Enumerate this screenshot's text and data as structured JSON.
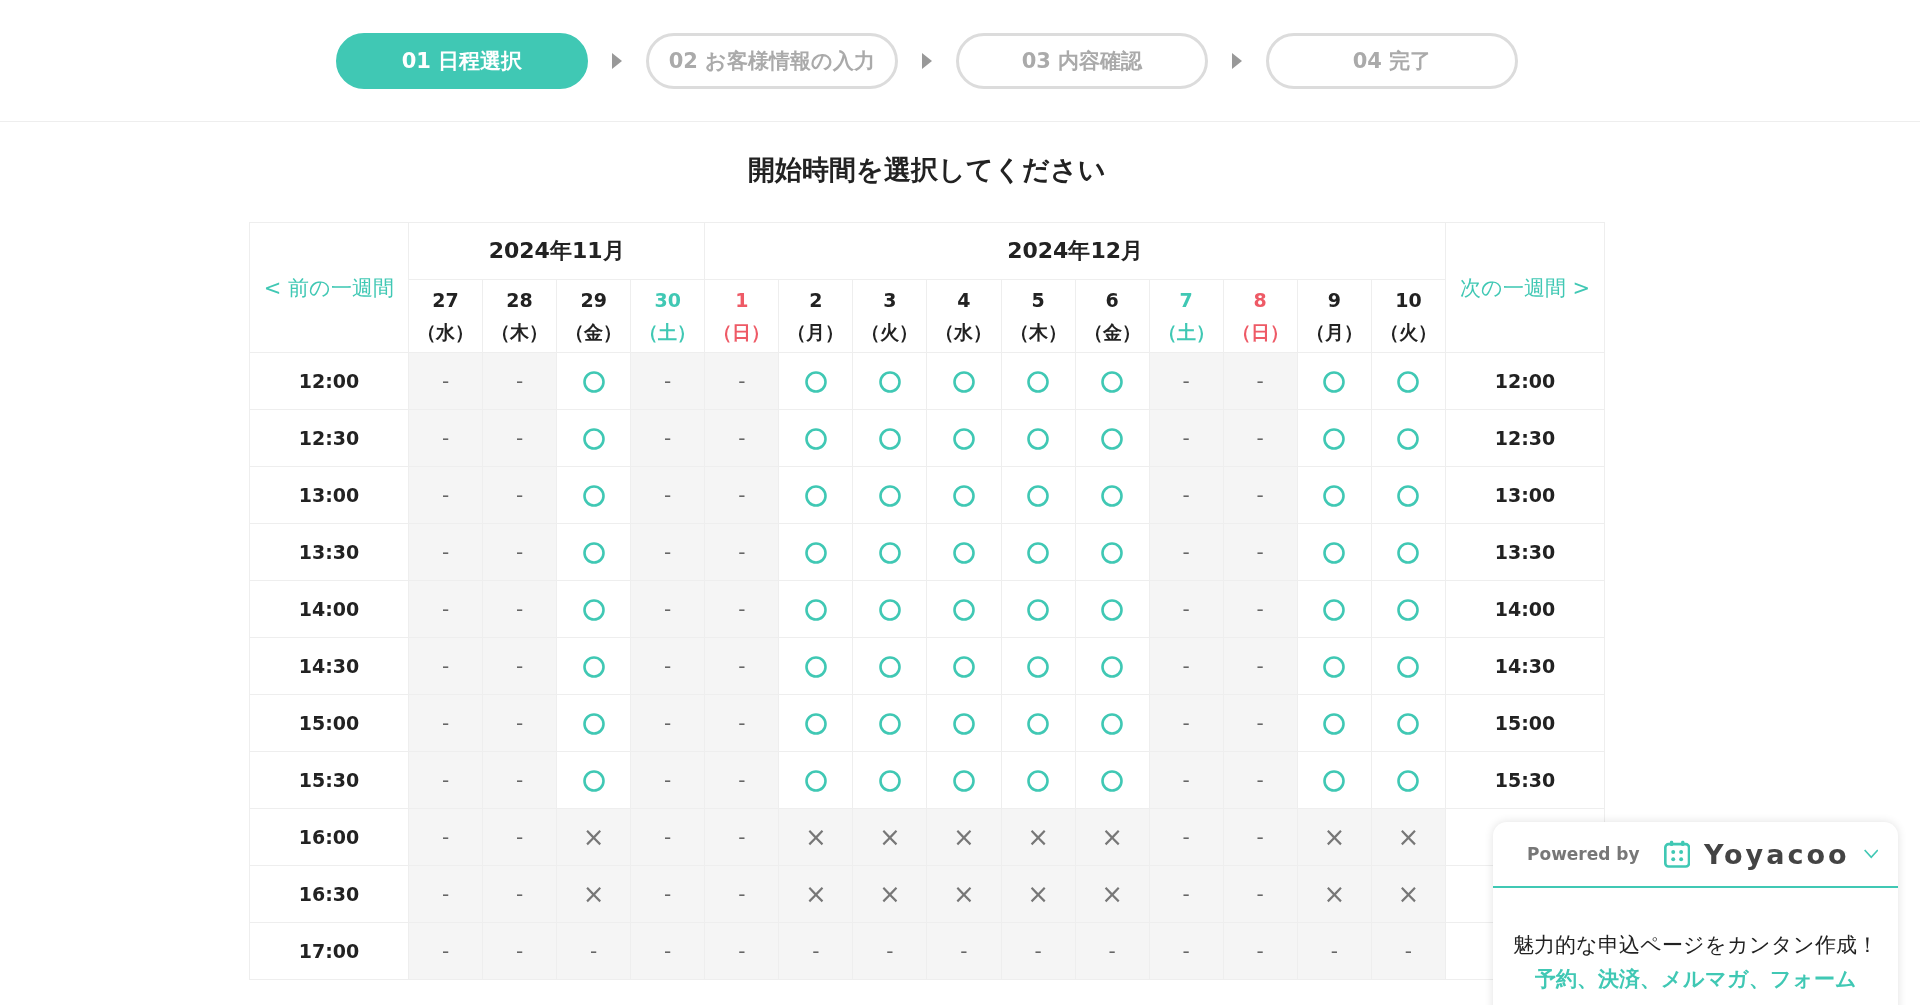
{
  "steps": [
    {
      "label": "01 日程選択",
      "selected": true
    },
    {
      "label": "02 お客様情報の入力",
      "selected": false
    },
    {
      "label": "03 内容確認",
      "selected": false
    },
    {
      "label": "04 完了",
      "selected": false
    }
  ],
  "title": "開始時間を選択してください",
  "table": {
    "prev_link": "< 前の一週間",
    "next_link": "次の一週間 >",
    "months": [
      {
        "label": "2024年11月",
        "days": [
          {
            "date": "27",
            "weekday": "（水）",
            "kind": "weekday"
          },
          {
            "date": "28",
            "weekday": "（木）",
            "kind": "weekday"
          },
          {
            "date": "29",
            "weekday": "（金）",
            "kind": "weekday"
          },
          {
            "date": "30",
            "weekday": "（土）",
            "kind": "saturday"
          }
        ]
      },
      {
        "label": "2024年12月",
        "days": [
          {
            "date": "1",
            "weekday": "（日）",
            "kind": "sunday"
          },
          {
            "date": "2",
            "weekday": "（月）",
            "kind": "weekday"
          },
          {
            "date": "3",
            "weekday": "（火）",
            "kind": "weekday"
          },
          {
            "date": "4",
            "weekday": "（水）",
            "kind": "weekday"
          },
          {
            "date": "5",
            "weekday": "（木）",
            "kind": "weekday"
          },
          {
            "date": "6",
            "weekday": "（金）",
            "kind": "weekday"
          },
          {
            "date": "7",
            "weekday": "（土）",
            "kind": "saturday"
          },
          {
            "date": "8",
            "weekday": "（日）",
            "kind": "sunday"
          },
          {
            "date": "9",
            "weekday": "（月）",
            "kind": "weekday"
          },
          {
            "date": "10",
            "weekday": "（火）",
            "kind": "weekday"
          }
        ]
      }
    ],
    "rows": [
      {
        "time": "12:00",
        "time_right": "12:00",
        "cells": [
          {
            "kind": "closed",
            "mark": "-"
          },
          {
            "kind": "closed",
            "mark": "-"
          },
          {
            "kind": "open"
          },
          {
            "kind": "closed",
            "mark": "-"
          },
          {
            "kind": "closed",
            "mark": "-"
          },
          {
            "kind": "open"
          },
          {
            "kind": "open"
          },
          {
            "kind": "open"
          },
          {
            "kind": "open"
          },
          {
            "kind": "open"
          },
          {
            "kind": "closed",
            "mark": "-"
          },
          {
            "kind": "closed",
            "mark": "-"
          },
          {
            "kind": "open"
          },
          {
            "kind": "open"
          }
        ]
      },
      {
        "time": "12:30",
        "time_right": "12:30",
        "cells": [
          {
            "kind": "closed",
            "mark": "-"
          },
          {
            "kind": "closed",
            "mark": "-"
          },
          {
            "kind": "open"
          },
          {
            "kind": "closed",
            "mark": "-"
          },
          {
            "kind": "closed",
            "mark": "-"
          },
          {
            "kind": "open"
          },
          {
            "kind": "open"
          },
          {
            "kind": "open"
          },
          {
            "kind": "open"
          },
          {
            "kind": "open"
          },
          {
            "kind": "closed",
            "mark": "-"
          },
          {
            "kind": "closed",
            "mark": "-"
          },
          {
            "kind": "open"
          },
          {
            "kind": "open"
          }
        ]
      },
      {
        "time": "13:00",
        "time_right": "13:00",
        "cells": [
          {
            "kind": "closed",
            "mark": "-"
          },
          {
            "kind": "closed",
            "mark": "-"
          },
          {
            "kind": "open"
          },
          {
            "kind": "closed",
            "mark": "-"
          },
          {
            "kind": "closed",
            "mark": "-"
          },
          {
            "kind": "open"
          },
          {
            "kind": "open"
          },
          {
            "kind": "open"
          },
          {
            "kind": "open"
          },
          {
            "kind": "open"
          },
          {
            "kind": "closed",
            "mark": "-"
          },
          {
            "kind": "closed",
            "mark": "-"
          },
          {
            "kind": "open"
          },
          {
            "kind": "open"
          }
        ]
      },
      {
        "time": "13:30",
        "time_right": "13:30",
        "cells": [
          {
            "kind": "closed",
            "mark": "-"
          },
          {
            "kind": "closed",
            "mark": "-"
          },
          {
            "kind": "open"
          },
          {
            "kind": "closed",
            "mark": "-"
          },
          {
            "kind": "closed",
            "mark": "-"
          },
          {
            "kind": "open"
          },
          {
            "kind": "open"
          },
          {
            "kind": "open"
          },
          {
            "kind": "open"
          },
          {
            "kind": "open"
          },
          {
            "kind": "closed",
            "mark": "-"
          },
          {
            "kind": "closed",
            "mark": "-"
          },
          {
            "kind": "open"
          },
          {
            "kind": "open"
          }
        ]
      },
      {
        "time": "14:00",
        "time_right": "14:00",
        "cells": [
          {
            "kind": "closed",
            "mark": "-"
          },
          {
            "kind": "closed",
            "mark": "-"
          },
          {
            "kind": "open"
          },
          {
            "kind": "closed",
            "mark": "-"
          },
          {
            "kind": "closed",
            "mark": "-"
          },
          {
            "kind": "open"
          },
          {
            "kind": "open"
          },
          {
            "kind": "open"
          },
          {
            "kind": "open"
          },
          {
            "kind": "open"
          },
          {
            "kind": "closed",
            "mark": "-"
          },
          {
            "kind": "closed",
            "mark": "-"
          },
          {
            "kind": "open"
          },
          {
            "kind": "open"
          }
        ]
      },
      {
        "time": "14:30",
        "time_right": "14:30",
        "cells": [
          {
            "kind": "closed",
            "mark": "-"
          },
          {
            "kind": "closed",
            "mark": "-"
          },
          {
            "kind": "open"
          },
          {
            "kind": "closed",
            "mark": "-"
          },
          {
            "kind": "closed",
            "mark": "-"
          },
          {
            "kind": "open"
          },
          {
            "kind": "open"
          },
          {
            "kind": "open"
          },
          {
            "kind": "open"
          },
          {
            "kind": "open"
          },
          {
            "kind": "closed",
            "mark": "-"
          },
          {
            "kind": "closed",
            "mark": "-"
          },
          {
            "kind": "open"
          },
          {
            "kind": "open"
          }
        ]
      },
      {
        "time": "15:00",
        "time_right": "15:00",
        "cells": [
          {
            "kind": "closed",
            "mark": "-"
          },
          {
            "kind": "closed",
            "mark": "-"
          },
          {
            "kind": "open"
          },
          {
            "kind": "closed",
            "mark": "-"
          },
          {
            "kind": "closed",
            "mark": "-"
          },
          {
            "kind": "open"
          },
          {
            "kind": "open"
          },
          {
            "kind": "open"
          },
          {
            "kind": "open"
          },
          {
            "kind": "open"
          },
          {
            "kind": "closed",
            "mark": "-"
          },
          {
            "kind": "closed",
            "mark": "-"
          },
          {
            "kind": "open"
          },
          {
            "kind": "open"
          }
        ]
      },
      {
        "time": "15:30",
        "time_right": "15:30",
        "cells": [
          {
            "kind": "closed",
            "mark": "-"
          },
          {
            "kind": "closed",
            "mark": "-"
          },
          {
            "kind": "open"
          },
          {
            "kind": "closed",
            "mark": "-"
          },
          {
            "kind": "closed",
            "mark": "-"
          },
          {
            "kind": "open"
          },
          {
            "kind": "open"
          },
          {
            "kind": "open"
          },
          {
            "kind": "open"
          },
          {
            "kind": "open"
          },
          {
            "kind": "closed",
            "mark": "-"
          },
          {
            "kind": "closed",
            "mark": "-"
          },
          {
            "kind": "open"
          },
          {
            "kind": "open"
          }
        ]
      },
      {
        "time": "16:00",
        "cells": [
          {
            "kind": "closed",
            "mark": "-"
          },
          {
            "kind": "closed",
            "mark": "-"
          },
          {
            "kind": "full",
            "mark": "×"
          },
          {
            "kind": "closed",
            "mark": "-"
          },
          {
            "kind": "closed",
            "mark": "-"
          },
          {
            "kind": "full",
            "mark": "×"
          },
          {
            "kind": "full",
            "mark": "×"
          },
          {
            "kind": "full",
            "mark": "×"
          },
          {
            "kind": "full",
            "mark": "×"
          },
          {
            "kind": "full",
            "mark": "×"
          },
          {
            "kind": "closed",
            "mark": "-"
          },
          {
            "kind": "closed",
            "mark": "-"
          },
          {
            "kind": "full",
            "mark": "×"
          },
          {
            "kind": "full",
            "mark": "×"
          }
        ]
      },
      {
        "time": "16:30",
        "cells": [
          {
            "kind": "closed",
            "mark": "-"
          },
          {
            "kind": "closed",
            "mark": "-"
          },
          {
            "kind": "full",
            "mark": "×"
          },
          {
            "kind": "closed",
            "mark": "-"
          },
          {
            "kind": "closed",
            "mark": "-"
          },
          {
            "kind": "full",
            "mark": "×"
          },
          {
            "kind": "full",
            "mark": "×"
          },
          {
            "kind": "full",
            "mark": "×"
          },
          {
            "kind": "full",
            "mark": "×"
          },
          {
            "kind": "full",
            "mark": "×"
          },
          {
            "kind": "closed",
            "mark": "-"
          },
          {
            "kind": "closed",
            "mark": "-"
          },
          {
            "kind": "full",
            "mark": "×"
          },
          {
            "kind": "full",
            "mark": "×"
          }
        ]
      },
      {
        "time": "17:00",
        "cells": [
          {
            "kind": "closed",
            "mark": "-"
          },
          {
            "kind": "closed",
            "mark": "-"
          },
          {
            "kind": "closed",
            "mark": "-"
          },
          {
            "kind": "closed",
            "mark": "-"
          },
          {
            "kind": "closed",
            "mark": "-"
          },
          {
            "kind": "closed",
            "mark": "-"
          },
          {
            "kind": "closed",
            "mark": "-"
          },
          {
            "kind": "closed",
            "mark": "-"
          },
          {
            "kind": "closed",
            "mark": "-"
          },
          {
            "kind": "closed",
            "mark": "-"
          },
          {
            "kind": "closed",
            "mark": "-"
          },
          {
            "kind": "closed",
            "mark": "-"
          },
          {
            "kind": "closed",
            "mark": "-"
          },
          {
            "kind": "closed",
            "mark": "-"
          }
        ]
      }
    ]
  },
  "widget": {
    "powered_by": "Powered by",
    "brand": "Yoyacoo",
    "lines": [
      {
        "text": "魅力的な申込ページをカンタン作成！",
        "kind": "plain"
      },
      {
        "text": "予約、決済、メルマガ、フォーム",
        "kind": "accent"
      }
    ]
  }
}
